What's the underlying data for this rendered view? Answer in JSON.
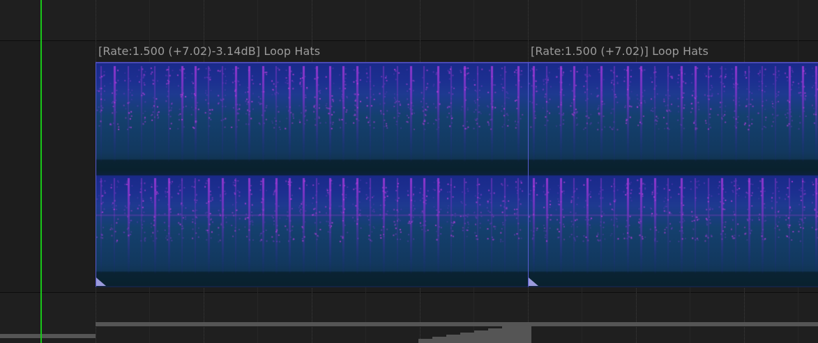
{
  "items": [
    {
      "label": "[Rate:1.500 (+7.02)-3.14dB] Loop Hats"
    },
    {
      "label": "[Rate:1.500 (+7.02)] Loop Hats"
    }
  ],
  "colors": {
    "background": "#1f1f1f",
    "edit_cursor": "#19c819",
    "spectral_base": "#1a2a8a",
    "spectral_peak": "#c040e0",
    "label_text": "#9c9c9c"
  }
}
